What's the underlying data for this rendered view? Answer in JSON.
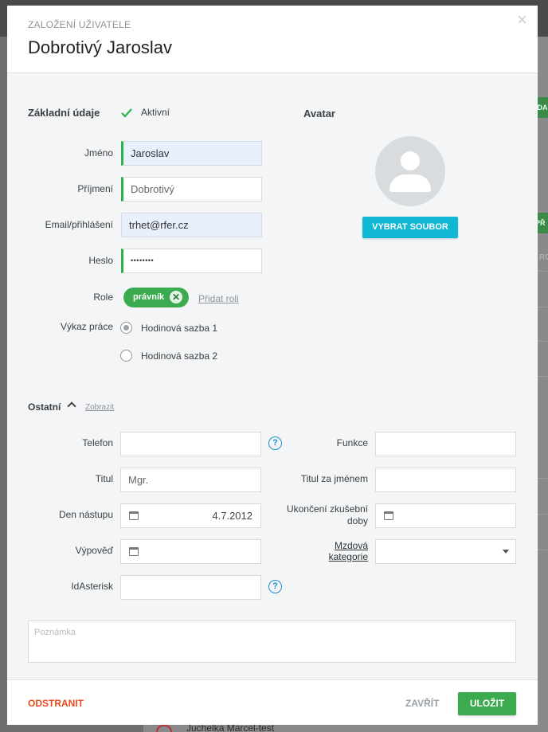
{
  "background": {
    "green_button_1": "IDA",
    "green_button_2": "PŘ",
    "side_text": "RO",
    "list_item": "Juchelka Marcel-test"
  },
  "header": {
    "subtitle": "ZALOŽENÍ UŽIVATELE",
    "title": "Dobrotivý Jaroslav",
    "close_icon": "×"
  },
  "basic": {
    "section_title": "Základní údaje",
    "active_label": "Aktivní",
    "first_name_label": "Jméno",
    "first_name_value": "Jaroslav",
    "last_name_label": "Příjmení",
    "last_name_value": "Dobrotivý",
    "email_label": "Email/přihlášení",
    "email_value": "trhet@rfer.cz",
    "password_label": "Heslo",
    "password_value": "••••••••",
    "role_label": "Role",
    "role_chip": "právník",
    "role_remove": "✕",
    "add_role": "Přidat roli",
    "work_report_label": "Výkaz práce",
    "work_report_options": [
      "Hodinová sazba 1",
      "Hodinová sazba 2"
    ],
    "work_report_selected": "Hodinová sazba 1"
  },
  "avatar": {
    "section_title": "Avatar",
    "choose_file": "VYBRAT SOUBOR"
  },
  "other": {
    "section_title": "Ostatní",
    "toggle_link": "Zobrazit",
    "phone_label": "Telefon",
    "phone_value": "",
    "function_label": "Funkce",
    "function_value": "",
    "title_label": "Titul",
    "title_value": "Mgr.",
    "title_after_label": "Titul za jménem",
    "title_after_value": "",
    "start_date_label": "Den nástupu",
    "start_date_value": "4.7.2012",
    "probation_end_label_1": "Ukončení zkušební",
    "probation_end_label_2": "doby",
    "probation_end_value": "",
    "notice_label": "Výpověď",
    "notice_value": "",
    "wage_category_label_1": "Mzdová",
    "wage_category_label_2": "kategorie",
    "wage_category_value": "",
    "asterisk_label": "IdAsterisk",
    "asterisk_value": "",
    "help_icon": "?"
  },
  "note": {
    "placeholder": "Poznámka"
  },
  "footer": {
    "delete": "ODSTRANIT",
    "close": "ZAVŘÍT",
    "save": "ULOŽIT"
  },
  "colors": {
    "accent_green": "#3cab4f",
    "accent_cyan": "#10b8d6",
    "danger": "#e8491d",
    "help_blue": "#1a8fd0"
  }
}
